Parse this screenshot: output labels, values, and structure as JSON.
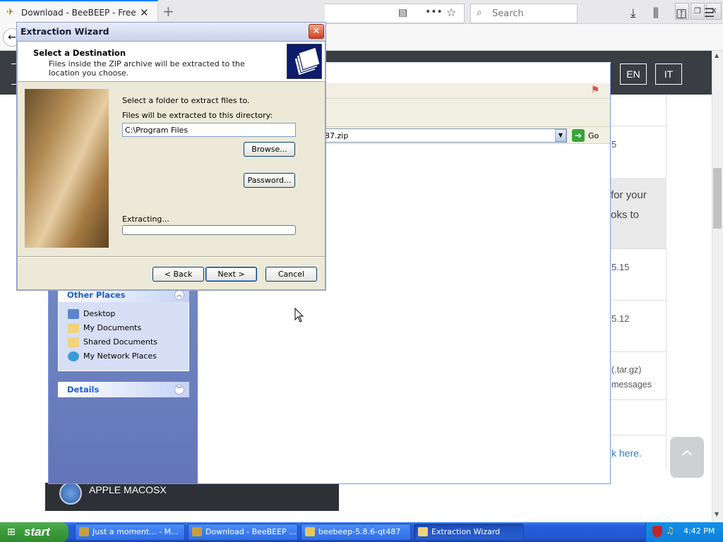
{
  "browser": {
    "tab_title": "Download - BeeBEEP - Free Office Messenger",
    "new_tab": "+",
    "search_placeholder": "Search",
    "win_minimize": "–",
    "win_restore": "❐",
    "win_close": "✕"
  },
  "website": {
    "lang_en": "EN",
    "lang_it": "IT",
    "side_texts": [
      "5",
      "for your",
      "oks to",
      "5.15",
      "5.12",
      "(.tar.gz)",
      "messages",
      "k here."
    ],
    "mac_label": "APPLE MACOSX",
    "scroll_top": "^"
  },
  "explorer": {
    "address_value": "87.zip",
    "go_label": "Go",
    "other_places_title": "Other Places",
    "other_places": [
      "Desktop",
      "My Documents",
      "Shared Documents",
      "My Network Places"
    ],
    "details_title": "Details"
  },
  "wizard": {
    "title": "Extraction Wizard",
    "header_title": "Select a Destination",
    "header_desc": "Files inside the ZIP archive will be extracted to the location you choose.",
    "select_label": "Select a folder to extract files to.",
    "dir_label": "Files will be extracted to this directory:",
    "dir_value": "C:\\Program Files",
    "browse_label": "Browse...",
    "password_label": "Password...",
    "extracting_label": "Extracting...",
    "progress": 0,
    "back_label": "< Back",
    "next_label": "Next >",
    "cancel_label": "Cancel"
  },
  "taskbar": {
    "start_label": "start",
    "items": [
      "Just a moment... - M...",
      "Download - BeeBEEP ...",
      "beebeep-5.8.6-qt487",
      "Extraction Wizard"
    ],
    "clock": "4:42 PM"
  }
}
